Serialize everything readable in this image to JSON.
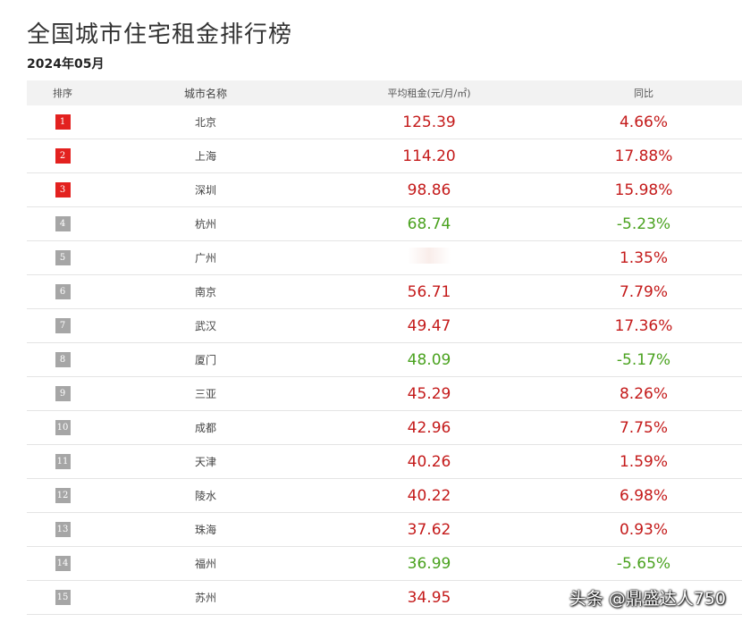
{
  "title": "全国城市住宅租金排行榜",
  "subtitle": "2024年05月",
  "columns": {
    "rank": "排序",
    "city": "城市名称",
    "rent": "平均租金(元/月/㎡)",
    "yoy": "同比"
  },
  "rows": [
    {
      "rank": "1",
      "city": "北京",
      "rent": "125.39",
      "yoy": "4.66%",
      "trend": "up",
      "top": true
    },
    {
      "rank": "2",
      "city": "上海",
      "rent": "114.20",
      "yoy": "17.88%",
      "trend": "up",
      "top": true
    },
    {
      "rank": "3",
      "city": "深圳",
      "rent": "98.86",
      "yoy": "15.98%",
      "trend": "up",
      "top": true
    },
    {
      "rank": "4",
      "city": "杭州",
      "rent": "68.74",
      "yoy": "-5.23%",
      "trend": "down",
      "top": false
    },
    {
      "rank": "5",
      "city": "广州",
      "rent": "",
      "yoy": "1.35%",
      "trend": "up",
      "top": false
    },
    {
      "rank": "6",
      "city": "南京",
      "rent": "56.71",
      "yoy": "7.79%",
      "trend": "up",
      "top": false
    },
    {
      "rank": "7",
      "city": "武汉",
      "rent": "49.47",
      "yoy": "17.36%",
      "trend": "up",
      "top": false
    },
    {
      "rank": "8",
      "city": "厦门",
      "rent": "48.09",
      "yoy": "-5.17%",
      "trend": "down",
      "top": false
    },
    {
      "rank": "9",
      "city": "三亚",
      "rent": "45.29",
      "yoy": "8.26%",
      "trend": "up",
      "top": false
    },
    {
      "rank": "10",
      "city": "成都",
      "rent": "42.96",
      "yoy": "7.75%",
      "trend": "up",
      "top": false
    },
    {
      "rank": "11",
      "city": "天津",
      "rent": "40.26",
      "yoy": "1.59%",
      "trend": "up",
      "top": false
    },
    {
      "rank": "12",
      "city": "陵水",
      "rent": "40.22",
      "yoy": "6.98%",
      "trend": "up",
      "top": false
    },
    {
      "rank": "13",
      "city": "珠海",
      "rent": "37.62",
      "yoy": "0.93%",
      "trend": "up",
      "top": false
    },
    {
      "rank": "14",
      "city": "福州",
      "rent": "36.99",
      "yoy": "-5.65%",
      "trend": "down",
      "top": false
    },
    {
      "rank": "15",
      "city": "苏州",
      "rent": "34.95",
      "yoy": "",
      "trend": "up",
      "top": false
    }
  ],
  "watermark": "头条 @鼎盛达人750",
  "colors": {
    "rank_top": "#e3211f",
    "rank_rest": "#a6a6a6",
    "up": "#c41a1a",
    "down": "#4aa21f",
    "header_bg": "#f2f2f2"
  }
}
